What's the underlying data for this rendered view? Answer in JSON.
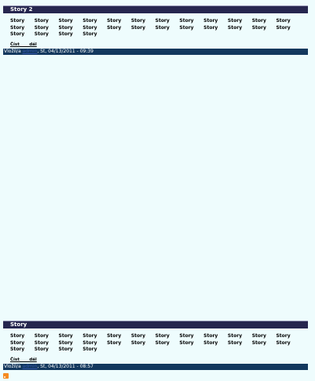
{
  "articles": [
    {
      "title": "Story 2",
      "body": "Story Story Story Story Story Story Story Story Story Story Story Story Story Story Story Story Story Story Story Story Story Story Story Story Story Story Story Story",
      "read_more": "Číst dál",
      "meta_prefix": "Vložil/a",
      "meta_user": "admin",
      "meta_date": ", St, 04/13/2011 - 09:39"
    },
    {
      "title": "Story",
      "body": "Story Story Story Story Story Story Story Story Story Story Story Story Story Story Story Story Story Story Story Story Story Story Story Story Story Story Story Story",
      "read_more": "Číst dál",
      "meta_prefix": "Vložil/a",
      "meta_user": "admin",
      "meta_date": ", St, 04/13/2011 - 08:57"
    }
  ],
  "feed": {
    "icon": "rss-feed-icon"
  },
  "colors": {
    "background": "#eefcfd",
    "title_bar": "#26264f",
    "meta_bar": "#13385e",
    "rss": "#f58a1f"
  }
}
